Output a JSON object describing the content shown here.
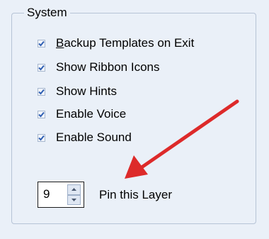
{
  "group": {
    "title": "System"
  },
  "options": [
    {
      "prefix": "",
      "underlined": "B",
      "rest": "ackup Templates on Exit",
      "checked": true
    },
    {
      "prefix": "",
      "underlined": "",
      "rest": "Show Ribbon Icons",
      "checked": true
    },
    {
      "prefix": "",
      "underlined": "",
      "rest": "Show Hints",
      "checked": true
    },
    {
      "prefix": "",
      "underlined": "",
      "rest": "Enable Voice",
      "checked": true
    },
    {
      "prefix": "",
      "underlined": "",
      "rest": "Enable Sound",
      "checked": true
    }
  ],
  "pin": {
    "value": "9",
    "label": "Pin this Layer"
  },
  "colors": {
    "accent": "#dd2a2a",
    "checkmark": "#2f5fb3",
    "panel_bg": "#eaf0f8"
  },
  "icons": {
    "annotation": "red-arrow",
    "check": "checkmark-icon",
    "spin_up": "up-triangle-icon",
    "spin_down": "down-triangle-icon"
  }
}
